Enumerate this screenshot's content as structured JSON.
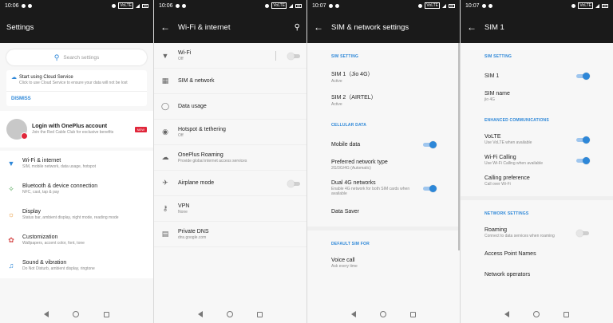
{
  "screens": {
    "settings": {
      "status_time": "10:06",
      "title": "Settings",
      "search_placeholder": "Search settings",
      "cloud": {
        "title": "Start using Cloud Service",
        "subtitle": "Click to use Cloud Service to ensure your data will not be lost",
        "dismiss": "DISMISS"
      },
      "login": {
        "title": "Login with OnePlus account",
        "subtitle": "Join the Red Cable Club for exclusive benefits",
        "badge": "NEW"
      },
      "items": [
        {
          "title": "Wi-Fi & internet",
          "subtitle": "SIM, mobile network, data usage, hotspot"
        },
        {
          "title": "Bluetooth & device connection",
          "subtitle": "NFC, cast, tap & pay"
        },
        {
          "title": "Display",
          "subtitle": "Status bar, ambient display, night mode, reading mode"
        },
        {
          "title": "Customization",
          "subtitle": "Wallpapers, accent color, font, tone"
        },
        {
          "title": "Sound & vibration",
          "subtitle": "Do Not Disturb, ambient display, ringtone"
        }
      ]
    },
    "wifi": {
      "status_time": "10:06",
      "title": "Wi-Fi & internet",
      "items": [
        {
          "title": "Wi-Fi",
          "subtitle": "Off",
          "toggle": false
        },
        {
          "title": "SIM & network",
          "subtitle": ""
        },
        {
          "title": "Data usage",
          "subtitle": ""
        },
        {
          "title": "Hotspot & tethering",
          "subtitle": "Off"
        },
        {
          "title": "OnePlus Roaming",
          "subtitle": "Provide global internet access services"
        },
        {
          "title": "Airplane mode",
          "subtitle": "",
          "toggle": false
        },
        {
          "title": "VPN",
          "subtitle": "None"
        },
        {
          "title": "Private DNS",
          "subtitle": "dns.google.com"
        }
      ]
    },
    "sim_network": {
      "status_time": "10:07",
      "title": "SIM & network settings",
      "sections": {
        "sim_setting": "SIM SETTING",
        "cellular_data": "CELLULAR DATA",
        "default_sim": "DEFAULT SIM FOR"
      },
      "sim1": {
        "title": "SIM 1（Jio 4G）",
        "subtitle": "Active"
      },
      "sim2": {
        "title": "SIM 2（AIRTEL）",
        "subtitle": "Active"
      },
      "mobile_data": {
        "title": "Mobile data",
        "toggle": true
      },
      "preferred_network": {
        "title": "Preferred network type",
        "subtitle": "2G/3G/4G (Automatic)"
      },
      "dual4g": {
        "title": "Dual 4G networks",
        "subtitle": "Enable 4G network for both SIM cards when available",
        "toggle": true
      },
      "data_saver": {
        "title": "Data Saver"
      },
      "voice_call": {
        "title": "Voice call",
        "subtitle": "Ask every time"
      }
    },
    "sim1": {
      "status_time": "10:07",
      "title": "SIM 1",
      "sections": {
        "sim_setting": "SIM SETTING",
        "enhanced": "ENHANCED COMMUNICATIONS",
        "network": "NETWORK SETTINGS"
      },
      "sim1": {
        "title": "SIM 1",
        "toggle": true
      },
      "sim_name": {
        "title": "SIM name",
        "subtitle": "jio 4G"
      },
      "volte": {
        "title": "VoLTE",
        "subtitle": "Use VoLTE when available",
        "toggle": true
      },
      "wifi_calling": {
        "title": "Wi-Fi Calling",
        "subtitle": "Use Wi-Fi Calling when available",
        "toggle": true
      },
      "calling_pref": {
        "title": "Calling preference",
        "subtitle": "Call over Wi-Fi"
      },
      "roaming": {
        "title": "Roaming",
        "subtitle": "Connect to data services when roaming",
        "toggle": false
      },
      "apn": {
        "title": "Access Point Names"
      },
      "operators": {
        "title": "Network operators"
      }
    }
  },
  "colors": {
    "accent": "#2d87d8",
    "appbar": "#1a1a1a",
    "badge": "#e0263a"
  }
}
